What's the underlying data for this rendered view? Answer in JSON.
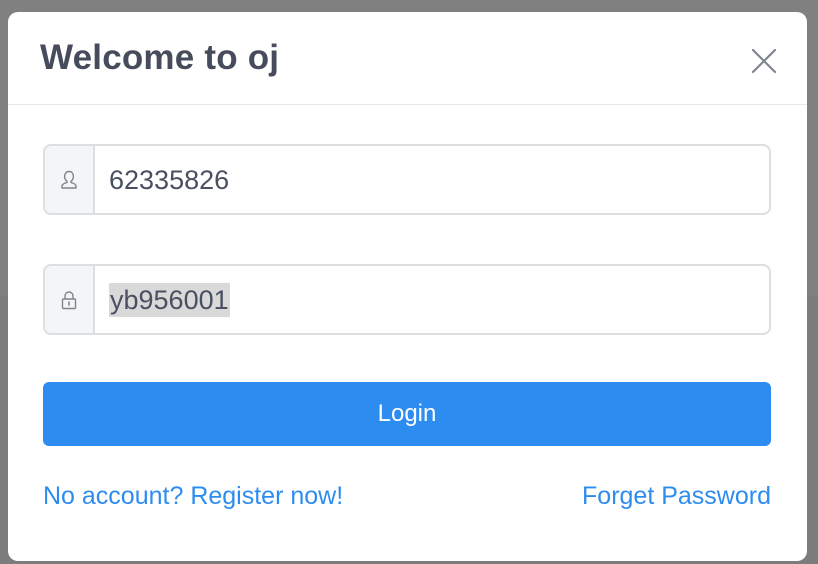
{
  "dialog": {
    "title": "Welcome to oj",
    "close_icon": "close-icon"
  },
  "form": {
    "username": {
      "icon": "user-icon",
      "value": "62335826"
    },
    "password": {
      "icon": "lock-icon",
      "value": "yb956001"
    },
    "login_label": "Login"
  },
  "links": {
    "register": "No account? Register now!",
    "forget_password": "Forget Password"
  },
  "colors": {
    "accent": "#2d8cf0",
    "title": "#464c5b",
    "overlay": "#808080"
  }
}
